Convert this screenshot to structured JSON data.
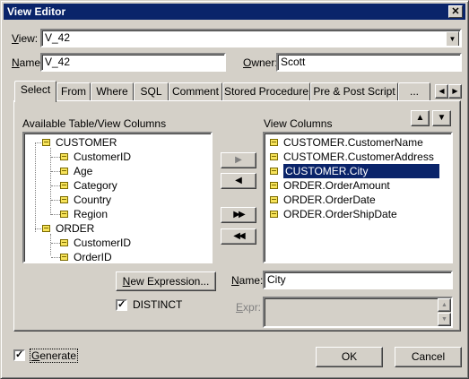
{
  "window": {
    "title": "View Editor",
    "close_glyph": "✕"
  },
  "view_field": {
    "label_u": "V",
    "label_rest": "iew:",
    "value": "V_42"
  },
  "name_field": {
    "label_u": "N",
    "label_rest": "ame:",
    "value": "V_42"
  },
  "owner_field": {
    "label_u": "O",
    "label_rest": "wner:",
    "value": "Scott"
  },
  "tabs": [
    {
      "label": "Select",
      "active": true
    },
    {
      "label": "From"
    },
    {
      "label": "Where"
    },
    {
      "label": "SQL"
    },
    {
      "label": "Comment"
    },
    {
      "label": "Stored Procedure"
    },
    {
      "label": "Pre & Post Script"
    },
    {
      "label": "..."
    }
  ],
  "available": {
    "label": "Available Table/View Columns",
    "tables": [
      {
        "name": "CUSTOMER",
        "columns": [
          "CustomerID",
          "Age",
          "Category",
          "Country",
          "Region"
        ]
      },
      {
        "name": "ORDER",
        "columns": [
          "CustomerID",
          "OrderID"
        ]
      }
    ]
  },
  "view_columns": {
    "label": "View Columns",
    "items": [
      "CUSTOMER.CustomerName",
      "CUSTOMER.CustomerAddress",
      "CUSTOMER.City",
      "ORDER.OrderAmount",
      "ORDER.OrderDate",
      "ORDER.OrderShipDate"
    ],
    "selected": "CUSTOMER.City"
  },
  "buttons": {
    "add_one": "▶",
    "remove_one": "◀",
    "add_all": "▶▶",
    "remove_all": "◀◀",
    "new_expr_u": "N",
    "new_expr_rest": "ew Expression...",
    "ok": "OK",
    "cancel": "Cancel",
    "move_up": "▲",
    "move_down": "▼",
    "tab_scroll_left": "◀",
    "tab_scroll_right": "▶"
  },
  "distinct": {
    "label": "DISTINCT",
    "checked": true
  },
  "col_name": {
    "label_u": "N",
    "label_rest": "ame:",
    "value": "City"
  },
  "expr": {
    "label_u": "E",
    "label_rest": "xpr:",
    "value": ""
  },
  "generate": {
    "label_u": "G",
    "label_rest": "enerate",
    "checked": true
  },
  "check_glyph": "✓"
}
